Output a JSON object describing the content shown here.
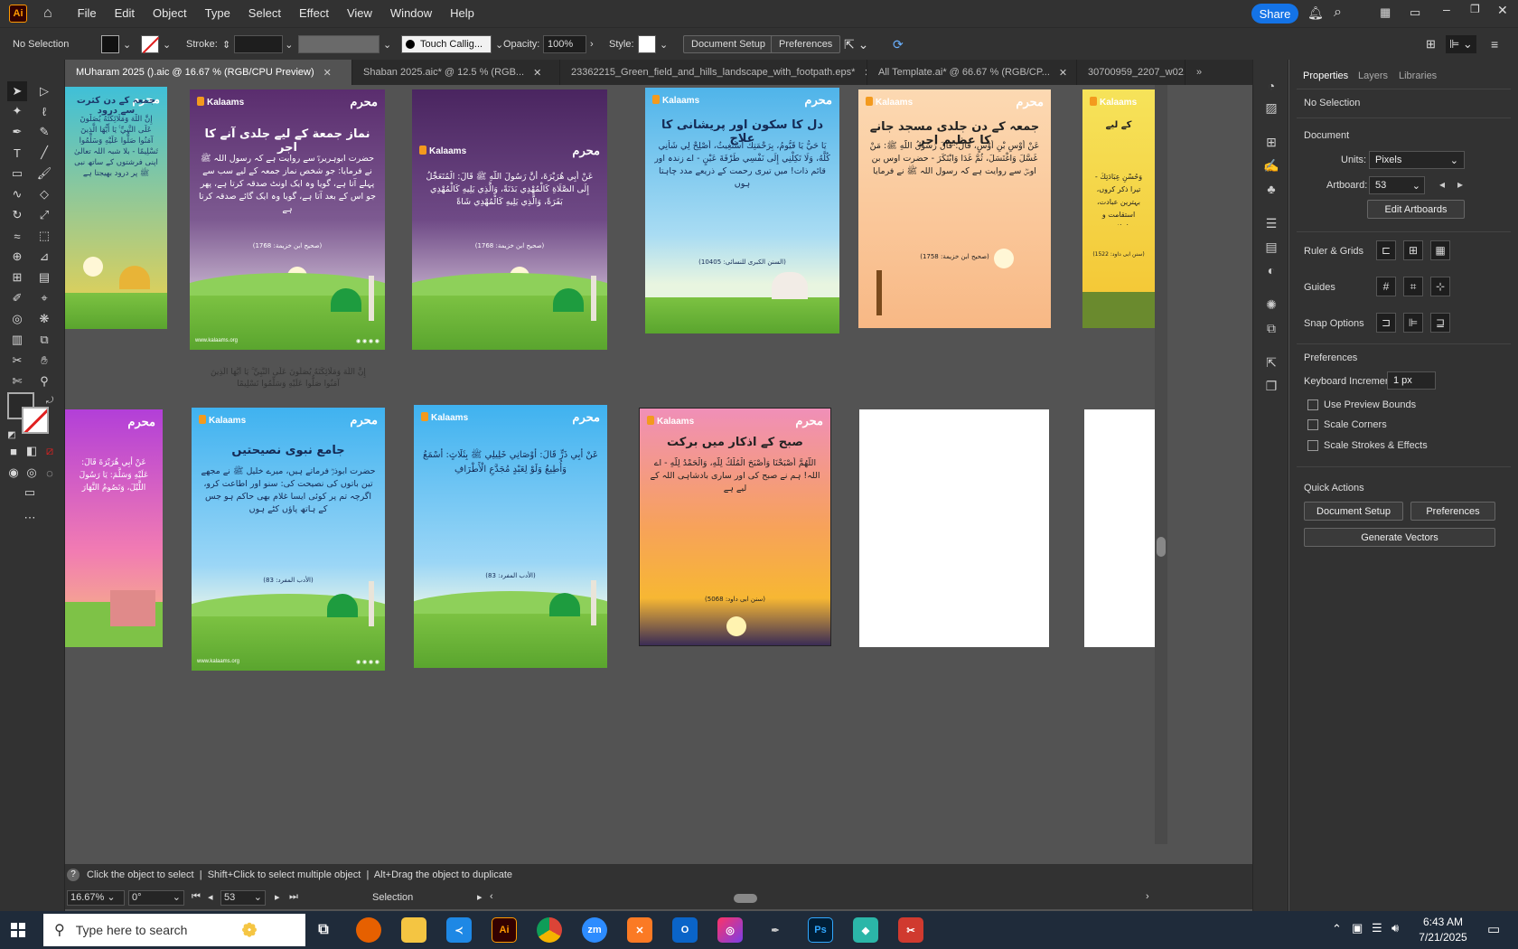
{
  "menubar": {
    "app_logo": "Ai",
    "menus": [
      "File",
      "Edit",
      "Object",
      "Type",
      "Select",
      "Effect",
      "View",
      "Window",
      "Help"
    ],
    "share_label": "Share",
    "icons": [
      "home-icon",
      "bell-icon",
      "search-icon",
      "arrange-icon",
      "minimize-icon",
      "restore-icon",
      "close-icon"
    ]
  },
  "controlbar": {
    "selection": "No Selection",
    "stroke_label": "Stroke:",
    "brush_name": "Touch Callig...",
    "opacity_label": "Opacity:",
    "opacity_value": "100%",
    "style_label": "Style:",
    "document_setup": "Document Setup",
    "preferences": "Preferences"
  },
  "tabs": [
    {
      "label": "MUharam 2025 ().aic @ 16.67 % (RGB/CPU Preview)",
      "active": true
    },
    {
      "label": "Shaban 2025.aic* @ 12.5 % (RGB...",
      "active": false
    },
    {
      "label": "23362215_Green_field_and_hills_landscape_with_footpath.eps*",
      "active": false
    },
    {
      "label": "All Template.ai* @ 66.67 % (RGB/CP...",
      "active": false
    },
    {
      "label": "30700959_2207_w02...",
      "active": false
    }
  ],
  "artboards": {
    "brand": "Kalaams",
    "logo_text": "محرم",
    "footer": "www.kalaams.org",
    "row1": [
      {
        "title": "جمعہ کے دن کثرت سے درود",
        "text": "إِنَّ اللَّهَ وَمَلَائِكَتَهُ يُصَلُّونَ عَلَى النَّبِيِّ ۚ يَا أَيُّهَا الَّذِينَ آمَنُوا صَلُّوا عَلَيْهِ وَسَلِّمُوا تَسْلِيمًا - بلا شبہ اللہ تعالیٰ اپنی فرشتوں کے ساتھ نبی ﷺ پر درود بھیجتا ہے"
      },
      {
        "title": "نماز جمعة کے لیے جلدی آنے کا اجر",
        "text": "حضرت ابوہریرہؓ سے روایت ہے کہ رسول اللہ ﷺ نے فرمایا: جو شخص نماز جمعہ کے لیے سب سے پہلے آتا ہے، گویا وہ ایک اونٹ صدقہ کرتا ہے، پھر جو اس کے بعد آتا ہے، گویا وہ ایک گائے صدقہ کرتا ہے",
        "ref": "(صحیح ابن خزیمة: 1768)"
      },
      {
        "title": "",
        "text": "عَنْ أَبِي هُرَيْرَةَ، أَنَّ رَسُولَ اللَّهِ ﷺ قَالَ: الْمُتَعَجِّلُ إِلَى الصَّلَاةِ كَالْمُهْدِي بَدَنَةً، وَالَّذِي يَلِيهِ كَالْمُهْدِي بَقَرَةً، وَالَّذِي يَلِيهِ كَالْمُهْدِي شَاةً",
        "ref": "(صحیح ابن خزیمة: 1768)"
      },
      {
        "title": "دل کا سکون اور پریشانی کا علاج",
        "text": "يَا حَيُّ يَا قَيُّومُ، بِرَحْمَتِكَ أَسْتَغِيثُ، أَصْلِحْ لِي شَأْنِي كُلَّهُ، وَلَا تَكِلْنِي إِلَى نَفْسِي طَرْفَةَ عَيْنٍ - اے زندہ اور قائم ذات! میں تیری رحمت کے ذریعے مدد چاہتا ہوں",
        "ref": "(السنن الکبری للنسائی: 10405)"
      },
      {
        "title": "جمعہ کے دن جلدی مسجد جانے کا عظیم اجر",
        "text": "عَنْ أَوْسِ بْنِ أَوْسٍ، قَالَ: قَالَ رَسُولُ اللَّهِ ﷺ: مَنْ غَسَّلَ وَاغْتَسَلَ، ثُمَّ غَدَا وَابْتَكَرَ - حضرت اوس بن اوسؓ سے روایت ہے کہ رسول اللہ ﷺ نے فرمایا",
        "ref": "(صحیح ابن خزیمة: 1758)"
      },
      {
        "title": "کے لیے",
        "text": "وَحُسْنِ عِبَادَتِكَ - تیرا ذکر کروں، بہترین عبادت، استقامت و اخلاص",
        "ref": "(سنن ابی داود: 1522)"
      }
    ],
    "row2": [
      {
        "title": "",
        "text": "عَنْ أَبِي هُرَيْرَةَ قَالَ: عَلَيْهِ وَسَلَّمَ: يَا رَسُولَ اللَّيْلَ، وَتَصُومُ النَّهَارَ"
      },
      {
        "title": "جامع نبوی نصیحتیں",
        "text": "حضرت ابوذرؓ فرماتے ہیں، میرے خلیل ﷺ نے مجھے تین باتوں کی نصیحت کی: سنو اور اطاعت کرو، اگرچہ تم پر کوئی ایسا غلام بھی حاکم ہو جس کے ہاتھ پاؤں کٹے ہوں",
        "ref": "(الأدب المفرد: 83)"
      },
      {
        "title": "",
        "text": "عَنْ أَبِي ذَرٍّ قَالَ: أَوْصَانِي خَلِيلِي ﷺ بِثَلَاثٍ: أَسْمَعُ وَأُطِيعُ وَلَوْ لِعَبْدٍ مُجَدَّعِ الْأَطْرَافِ",
        "ref": "(الأدب المفرد: 83)"
      },
      {
        "title": "صبح کے اذکار میں برکت",
        "text": "اللَّهُمَّ أَصْبَحْنَا وَأَصْبَحَ الْمُلْكُ لِلَّهِ، وَالْحَمْدُ لِلَّهِ - اے اللہ! ہم نے صبح کی اور ساری بادشاہی اللہ کے لیے ہے",
        "ref": "(سنن ابی داود: 5068)"
      }
    ],
    "stray_text": "إِنَّ اللَّهَ وَمَلَائِكَتَهُ يُصَلُّونَ عَلَى النَّبِيِّ ۚ يَا أَيُّهَا الَّذِينَ آمَنُوا صَلُّوا عَلَيْهِ وَسَلِّمُوا تَسْلِيمًا"
  },
  "properties": {
    "tabs": [
      "Properties",
      "Layers",
      "Libraries"
    ],
    "selection": "No Selection",
    "document_heading": "Document",
    "units_label": "Units:",
    "units_value": "Pixels",
    "artboard_label": "Artboard:",
    "artboard_value": "53",
    "edit_artboards": "Edit Artboards",
    "ruler_grids": "Ruler & Grids",
    "guides": "Guides",
    "snap_options": "Snap Options",
    "preferences_heading": "Preferences",
    "keyboard_increment_label": "Keyboard Increment:",
    "keyboard_increment_value": "1 px",
    "use_preview_bounds": "Use Preview Bounds",
    "scale_corners": "Scale Corners",
    "scale_strokes": "Scale Strokes & Effects",
    "quick_actions": "Quick Actions",
    "document_setup_btn": "Document Setup",
    "preferences_btn": "Preferences",
    "generate_vectors": "Generate Vectors"
  },
  "statusbar": {
    "hint": "Click the object to select  |  Shift+Click to select multiple object  |  Alt+Drag the object to duplicate",
    "zoom": "16.67%",
    "rotation": "0°",
    "artboard_nav": "53",
    "mode": "Selection"
  },
  "taskbar": {
    "search_placeholder": "Type here to search",
    "time": "6:43 AM",
    "date": "7/21/2025",
    "apps": [
      "Ai",
      "Ps",
      "zm"
    ]
  },
  "colors": {
    "accent": "#1473e6",
    "ui_dark": "#323232",
    "canvas": "#535353"
  }
}
